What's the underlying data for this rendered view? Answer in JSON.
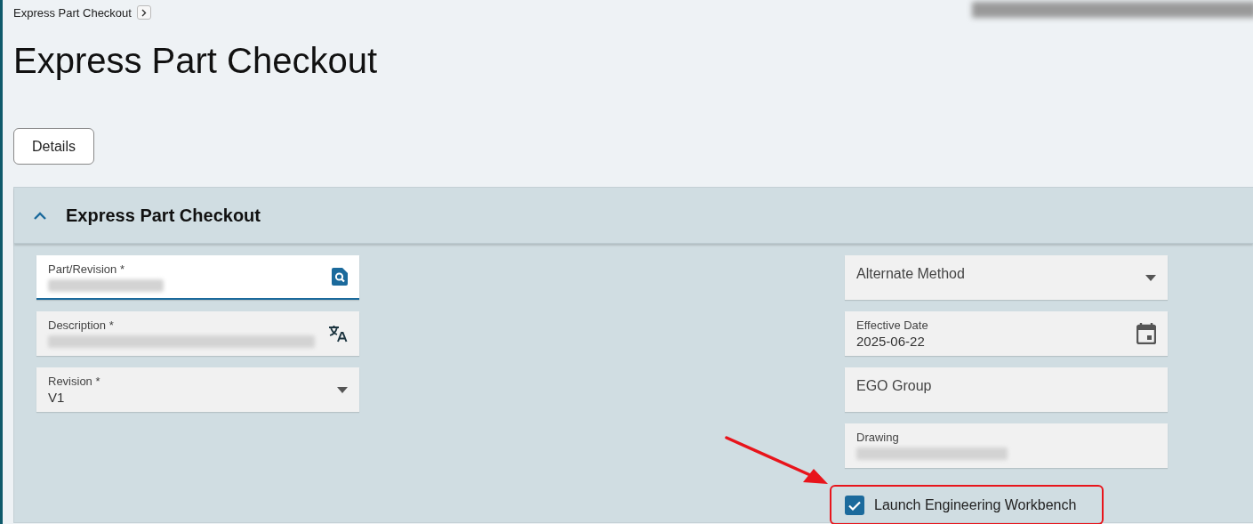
{
  "breadcrumb": {
    "label": "Express Part Checkout"
  },
  "page_title": "Express Part Checkout",
  "url_blurred": true,
  "buttons": [
    {
      "label": "Details"
    }
  ],
  "section": {
    "title": "Express Part Checkout",
    "expanded": true,
    "left_fields": [
      {
        "kind": "lookup",
        "label": "Part/Revision *",
        "blurred": true,
        "focused": true
      },
      {
        "kind": "translate",
        "label": "Description *",
        "blurred": true,
        "focused": false
      },
      {
        "kind": "select",
        "label": "Revision *",
        "value": "V1",
        "focused": false
      }
    ],
    "right_fields": [
      {
        "kind": "select",
        "label": "Alternate Method",
        "focused": false
      },
      {
        "kind": "date",
        "label": "Effective Date",
        "value": "2025-06-22",
        "focused": false
      },
      {
        "kind": "text",
        "label": "EGO Group",
        "focused": false
      },
      {
        "kind": "text",
        "label": "Drawing",
        "blurred": true,
        "focused": false
      }
    ],
    "checkbox": {
      "label": "Launch Engineering Workbench",
      "checked": true,
      "highlighted": true
    }
  }
}
